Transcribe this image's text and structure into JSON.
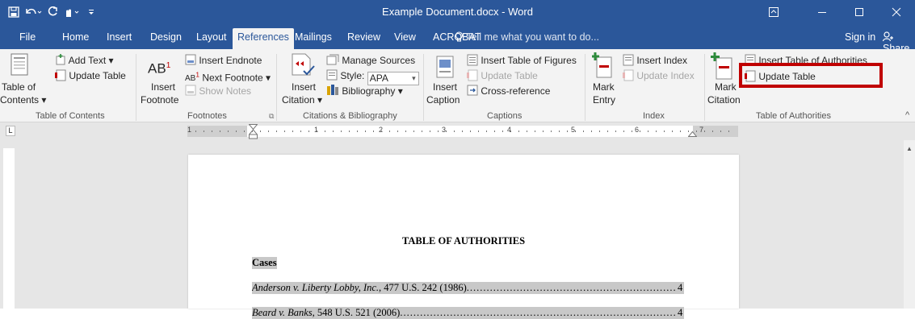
{
  "window": {
    "title": "Example Document.docx - Word"
  },
  "tabs": [
    {
      "label": "File"
    },
    {
      "label": "Home"
    },
    {
      "label": "Insert"
    },
    {
      "label": "Design"
    },
    {
      "label": "Layout"
    },
    {
      "label": "References"
    },
    {
      "label": "Mailings"
    },
    {
      "label": "Review"
    },
    {
      "label": "View"
    },
    {
      "label": "ACROBAT"
    }
  ],
  "tellme": "Tell me what you want to do...",
  "signin": "Sign in",
  "share": "Share",
  "ribbon": {
    "toc": {
      "table_of": "Table of",
      "contents": "Contents",
      "add_text": "Add Text",
      "update_table": "Update Table",
      "group": "Table of Contents"
    },
    "footnotes": {
      "ab": "AB",
      "sup": "1",
      "insert": "Insert",
      "footnote": "Footnote",
      "insert_endnote": "Insert Endnote",
      "next_footnote": "Next Footnote",
      "show_notes": "Show Notes",
      "group": "Footnotes"
    },
    "citations": {
      "insert": "Insert",
      "citation": "Citation",
      "manage_sources": "Manage Sources",
      "style_label": "Style:",
      "style_value": "APA",
      "bibliography": "Bibliography",
      "group": "Citations & Bibliography"
    },
    "captions": {
      "insert": "Insert",
      "caption": "Caption",
      "insert_tof": "Insert Table of Figures",
      "update_table": "Update Table",
      "cross_reference": "Cross-reference",
      "group": "Captions"
    },
    "index": {
      "mark": "Mark",
      "entry": "Entry",
      "insert_index": "Insert Index",
      "update_index": "Update Index",
      "group": "Index"
    },
    "toa": {
      "mark": "Mark",
      "citation": "Citation",
      "insert_toa": "Insert Table of Authorities",
      "update_table": "Update Table",
      "group": "Table of Authorities"
    }
  },
  "ruler": {
    "numbers": [
      "1",
      "1",
      "2",
      "3",
      "4",
      "5",
      "6",
      "7"
    ]
  },
  "document": {
    "heading": "TABLE OF AUTHORITIES",
    "section": "Cases",
    "entries": [
      {
        "case": "Anderson v. Liberty Lobby, Inc.",
        "cite": ", 477 U.S. 242 (1986)",
        "page": "4"
      },
      {
        "case": "Beard v. Banks",
        "cite": ", 548 U.S. 521 (2006)",
        "page": "4"
      }
    ]
  },
  "colors": {
    "brand": "#2b579a",
    "highlight": "#c00000"
  }
}
